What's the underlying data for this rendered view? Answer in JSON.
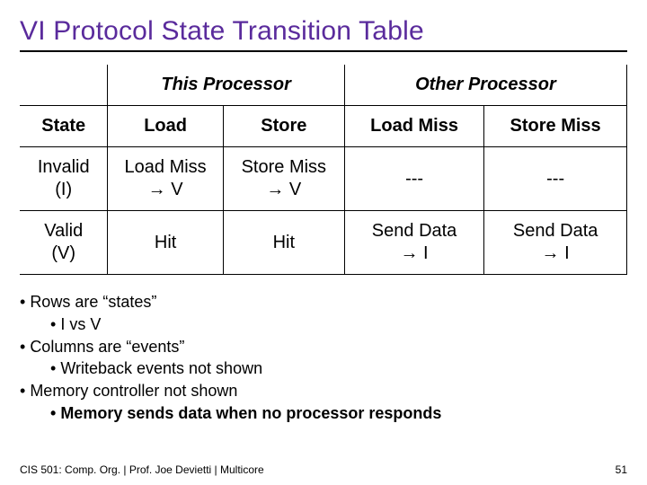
{
  "title": "VI Protocol State Transition Table",
  "table": {
    "group_headers": {
      "this": "This Processor",
      "other": "Other Processor"
    },
    "col_headers": {
      "state": "State",
      "load": "Load",
      "store": "Store",
      "load_miss": "Load Miss",
      "store_miss": "Store Miss"
    },
    "rows": [
      {
        "state_line1": "Invalid",
        "state_line2": "(I)",
        "load_line1": "Load Miss",
        "load_line2": "→ V",
        "store_line1": "Store Miss",
        "store_line2": "→ V",
        "other_load": "---",
        "other_store": "---"
      },
      {
        "state_line1": "Valid",
        "state_line2": "(V)",
        "load_line1": "Hit",
        "load_line2": "",
        "store_line1": "Hit",
        "store_line2": "",
        "other_load_line1": "Send Data",
        "other_load_line2": "→ I",
        "other_store_line1": "Send Data",
        "other_store_line2": "→ I"
      }
    ]
  },
  "bullets": {
    "b1": "Rows are “states”",
    "b1a": "I vs V",
    "b2": "Columns are “events”",
    "b2a": "Writeback events not shown",
    "b3": "Memory controller not shown",
    "b3a": "Memory sends data when no processor responds"
  },
  "footer": {
    "left": "CIS 501: Comp. Org. |  Prof. Joe Devietti  |  Multicore",
    "right": "51"
  }
}
